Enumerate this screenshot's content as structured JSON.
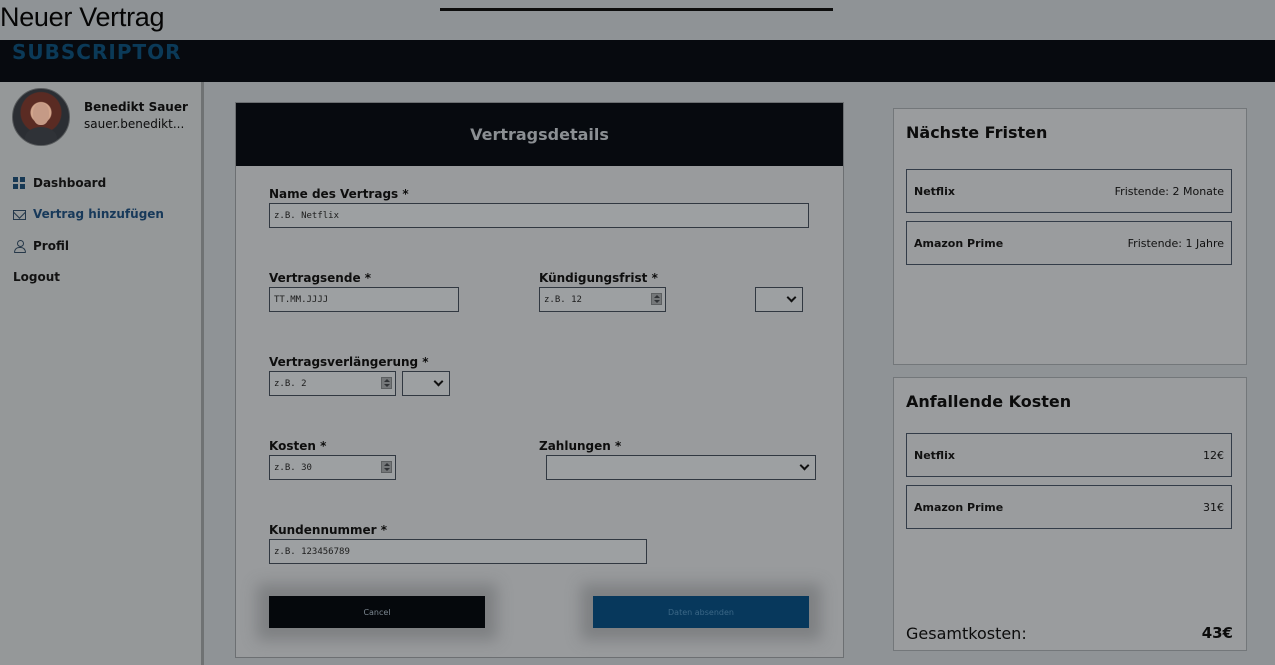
{
  "page": {
    "heading": "Neuer Vertrag",
    "brand": "SUBSCRIPTOR"
  },
  "user": {
    "name": "Benedikt Sauer",
    "email": "sauer.benedikt..."
  },
  "sidebar": {
    "items": [
      {
        "label": "Dashboard",
        "icon": "dashboard-icon"
      },
      {
        "label": "Vertrag hinzufügen",
        "icon": "mail-icon",
        "active": true
      },
      {
        "label": "Profil",
        "icon": "user-icon"
      },
      {
        "label": "Logout"
      }
    ]
  },
  "form": {
    "title": "Vertragsdetails",
    "contract_name_label": "Name des Vertrags *",
    "contract_name_placeholder": "z.B. Netflix",
    "contract_end_label": "Vertragsende *",
    "contract_end_placeholder": "TT.MM.JJJJ",
    "notice_period_label": "Kündigungsfrist *",
    "notice_period_placeholder": "z.B. 12",
    "renewal_label": "Vertragsverlängerung *",
    "renewal_placeholder": "z.B. 2",
    "cost_label": "Kosten *",
    "cost_placeholder": "z.B. 30",
    "payments_label": "Zahlungen *",
    "customer_number_label": "Kundennummer *",
    "customer_number_placeholder": "z.B. 123456789",
    "cancel_label": "Cancel",
    "submit_label": "Daten absenden"
  },
  "deadlines": {
    "title": "Nächste Fristen",
    "items": [
      {
        "name": "Netflix",
        "value": "Fristende: 2 Monate"
      },
      {
        "name": "Amazon Prime",
        "value": "Fristende: 1 Jahre"
      }
    ]
  },
  "costs": {
    "title": "Anfallende Kosten",
    "items": [
      {
        "name": "Netflix",
        "value": "12€"
      },
      {
        "name": "Amazon Prime",
        "value": "31€"
      }
    ],
    "total_label": "Gesamtkosten:",
    "total_value": "43€"
  }
}
